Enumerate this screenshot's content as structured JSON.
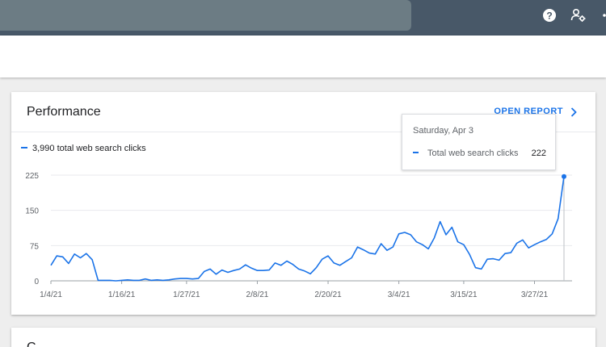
{
  "topbar": {
    "icons": [
      "help-icon",
      "manage-users-icon",
      "apps-icon"
    ]
  },
  "performance": {
    "title": "Performance",
    "open_report_label": "OPEN REPORT",
    "legend_label": "3,990 total web search clicks"
  },
  "tooltip": {
    "date": "Saturday, Apr 3",
    "series_label": "Total web search clicks",
    "value": "222"
  },
  "next_card": {
    "title": "C"
  },
  "colors": {
    "accent": "#1a73e8",
    "topbar": "#485868"
  },
  "chart_data": {
    "type": "line",
    "title": "",
    "xlabel": "",
    "ylabel": "",
    "ylim": [
      0,
      225
    ],
    "y_ticks": [
      0,
      75,
      150,
      225
    ],
    "x_ticks": [
      "1/4/21",
      "1/16/21",
      "1/27/21",
      "2/8/21",
      "2/20/21",
      "3/4/21",
      "3/15/21",
      "3/27/21"
    ],
    "x_start": "1/4/21",
    "x_end": "4/3/21",
    "grid": true,
    "legend": "top-left",
    "series": [
      {
        "name": "Total web search clicks",
        "values": [
          33,
          53,
          51,
          37,
          57,
          49,
          58,
          45,
          1,
          1,
          1,
          0,
          1,
          2,
          1,
          1,
          4,
          1,
          2,
          1,
          2,
          4,
          5,
          5,
          4,
          5,
          20,
          25,
          14,
          23,
          18,
          22,
          25,
          34,
          27,
          22,
          22,
          23,
          38,
          33,
          42,
          35,
          25,
          21,
          15,
          28,
          46,
          53,
          38,
          33,
          41,
          49,
          72,
          66,
          59,
          57,
          79,
          65,
          72,
          100,
          103,
          98,
          83,
          77,
          68,
          91,
          126,
          98,
          114,
          83,
          77,
          56,
          28,
          25,
          46,
          47,
          44,
          58,
          60,
          80,
          87,
          70,
          77,
          83,
          88,
          100,
          132,
          222
        ]
      }
    ]
  }
}
